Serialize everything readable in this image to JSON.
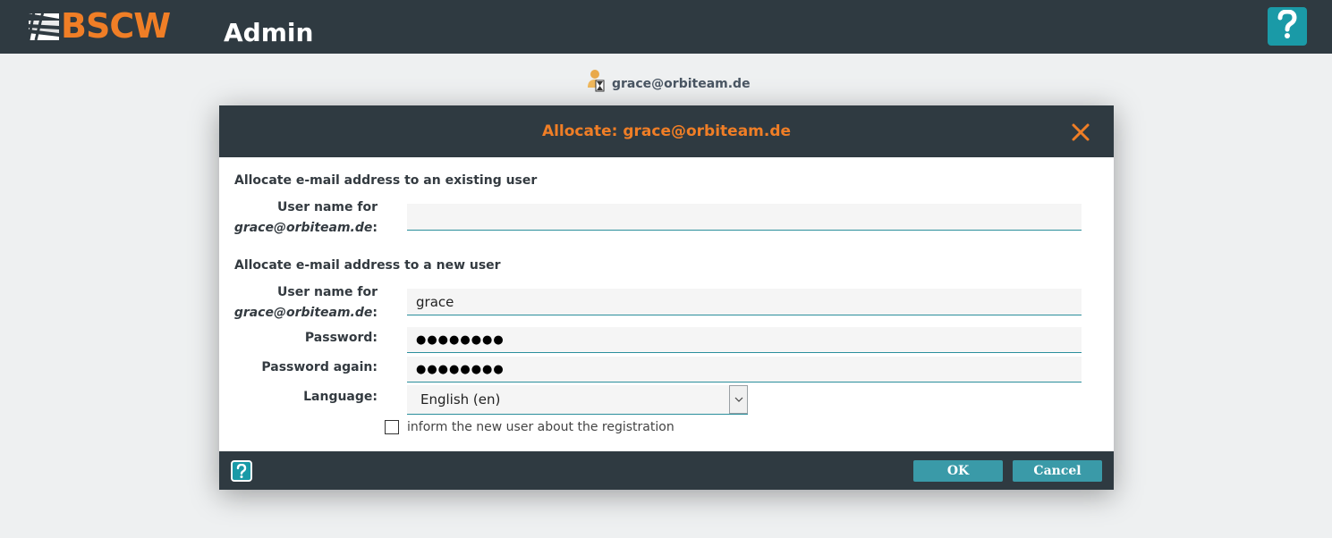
{
  "header": {
    "logo_text": "BSCW",
    "title": "Admin"
  },
  "user": {
    "email": "grace@orbiteam.de"
  },
  "dialog": {
    "title": "Allocate: grace@orbiteam.de",
    "existing": {
      "heading": "Allocate e-mail address to an existing user",
      "label_line1": "User name for",
      "label_email": "grace@orbiteam.de",
      "value": ""
    },
    "new": {
      "heading": "Allocate e-mail address to a new user",
      "label_line1": "User name for",
      "label_email": "grace@orbiteam.de",
      "username_value": "grace",
      "password_label": "Password:",
      "password_value": "●●●●●●●●",
      "password_again_label": "Password again:",
      "password_again_value": "●●●●●●●●",
      "language_label": "Language:",
      "language_value": "English (en)",
      "inform_label": "inform the new user about the registration"
    },
    "buttons": {
      "ok": "OK",
      "cancel": "Cancel"
    }
  },
  "colors": {
    "header_bg": "#2f3a41",
    "accent_orange": "#f07e26",
    "teal": "#1a9aa7",
    "button": "#3a9aa8"
  },
  "icons": {
    "logo": "bscw-logo-icon",
    "help": "help-icon",
    "user": "user-pending-icon",
    "close": "close-icon",
    "dropdown": "chevron-down-icon"
  }
}
